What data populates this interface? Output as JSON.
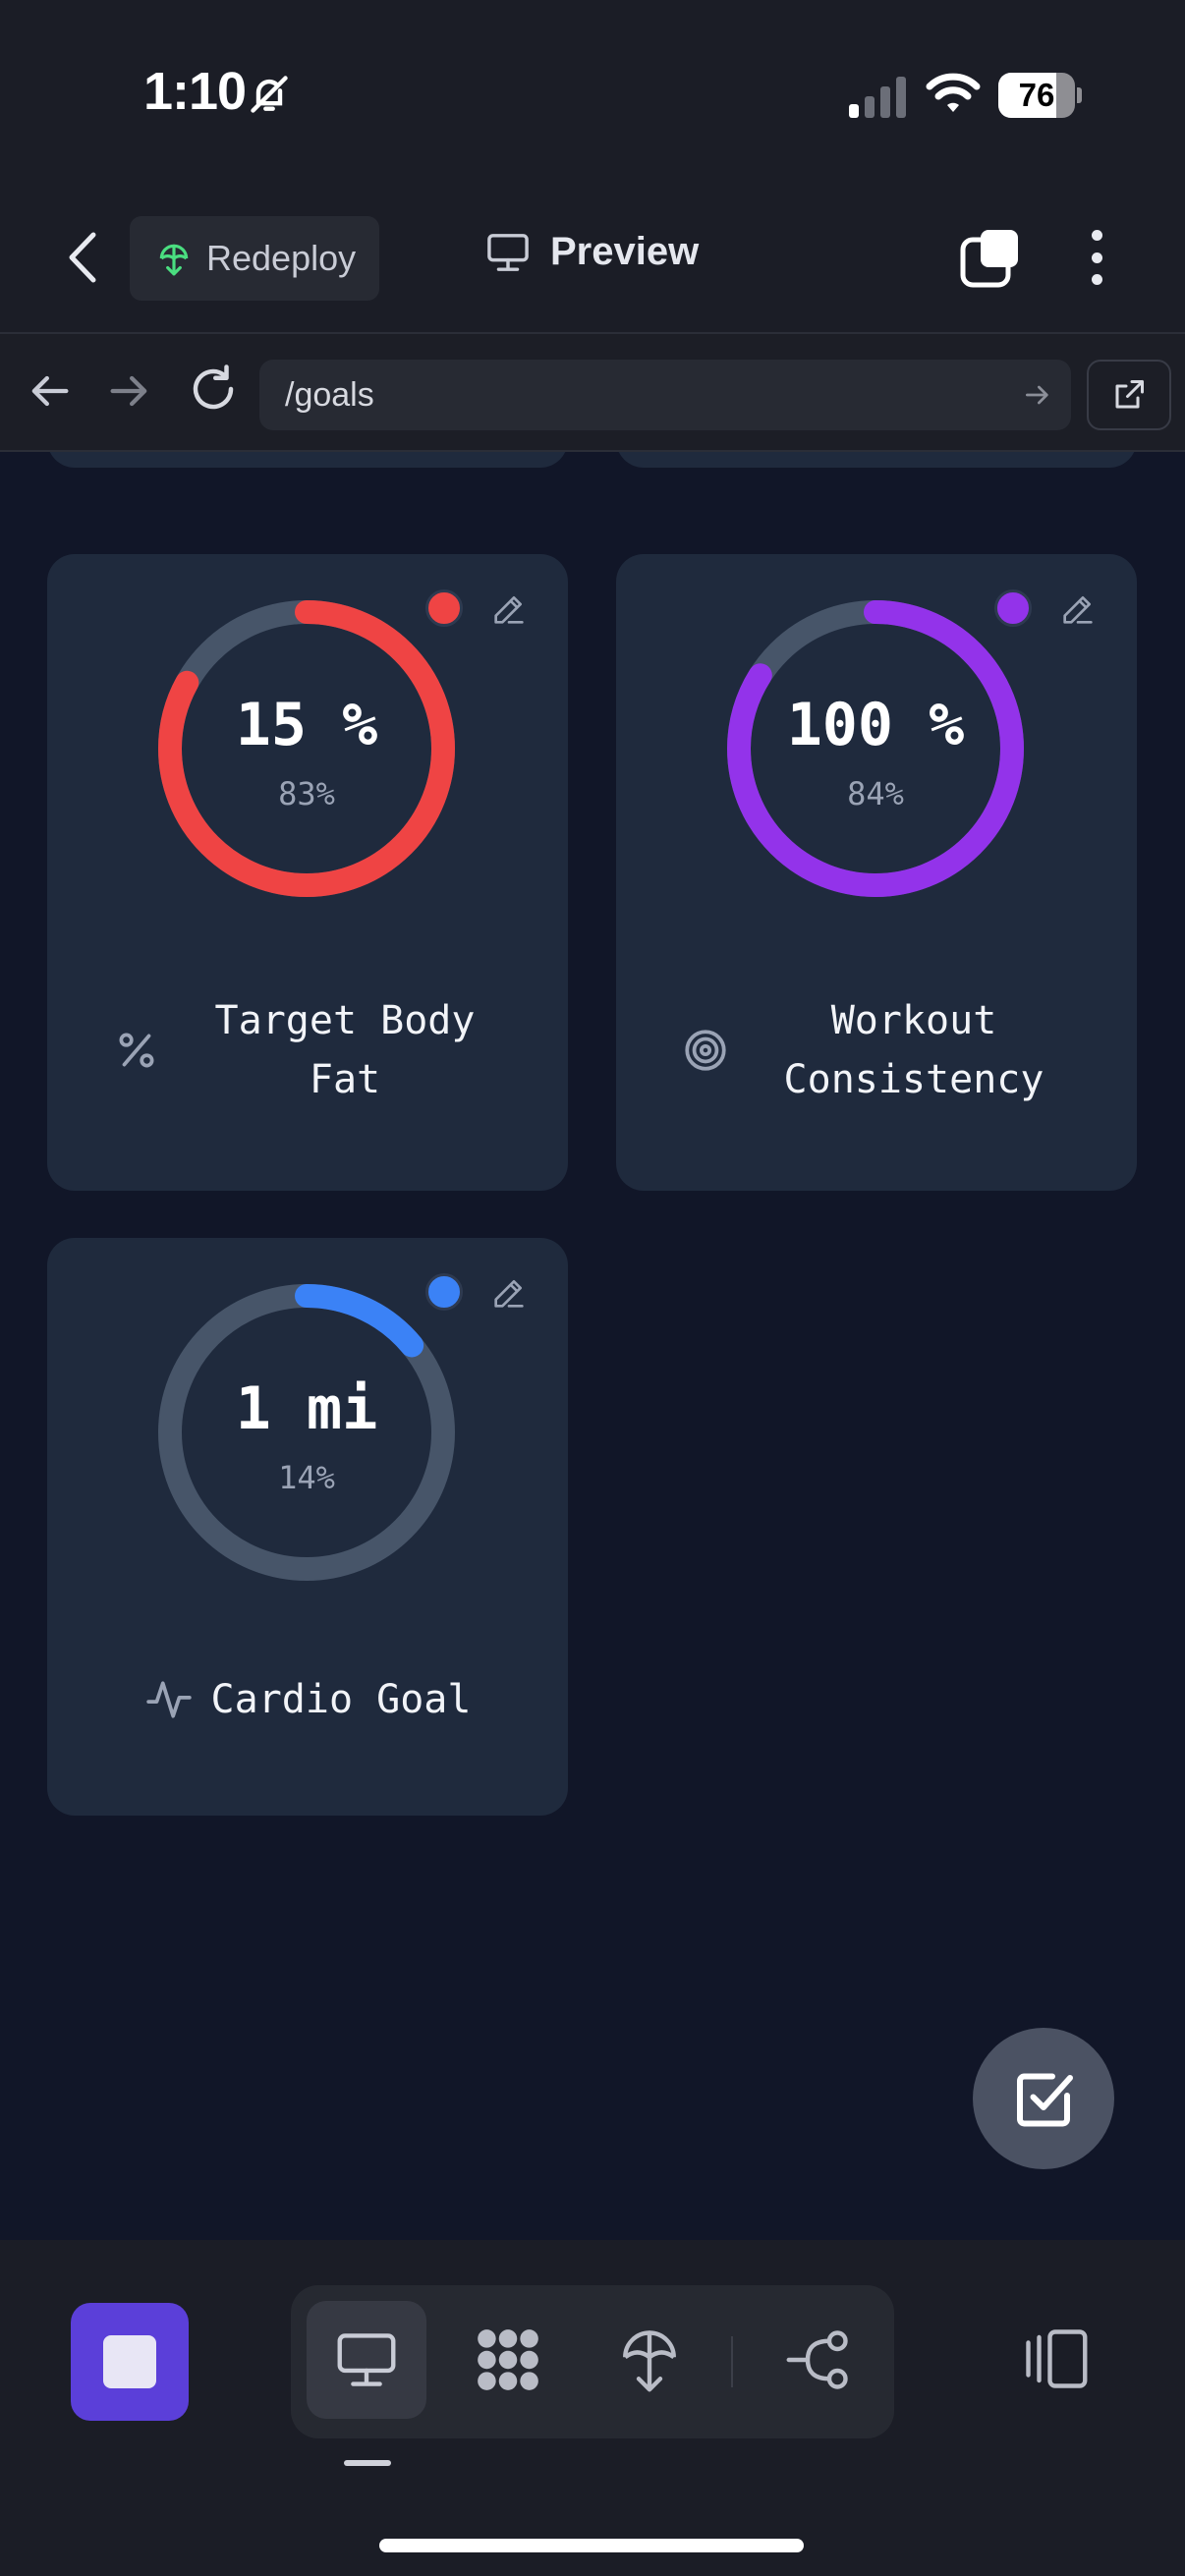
{
  "status_bar": {
    "time": "1:10",
    "battery_level": "76",
    "battery_fraction": 0.76
  },
  "header": {
    "redeploy_label": "Redeploy",
    "preview_label": "Preview"
  },
  "url_bar": {
    "url": "/goals"
  },
  "goals": [
    {
      "value": "15 %",
      "percent_label": "83%",
      "progress": 0.83,
      "color": "#ef4444",
      "title": "Target Body Fat",
      "icon": "percent-icon"
    },
    {
      "value": "100 %",
      "percent_label": "84%",
      "progress": 0.84,
      "color": "#9333ea",
      "title": "Workout Consistency",
      "icon": "target-icon"
    },
    {
      "value": "1 mi",
      "percent_label": "14%",
      "progress": 0.14,
      "color": "#3b82f6",
      "title": "Cardio Goal",
      "icon": "activity-icon"
    }
  ],
  "colors": {
    "ring_track": "#475569",
    "card_bg": "#1f2a3d",
    "page_bg": "#111628",
    "stop_button": "#5b3fd9"
  },
  "bottom_bar": {
    "tools": [
      "monitor-icon",
      "grid-icon",
      "deploy-icon",
      "workflow-icon"
    ],
    "active_tool": "monitor-icon"
  }
}
